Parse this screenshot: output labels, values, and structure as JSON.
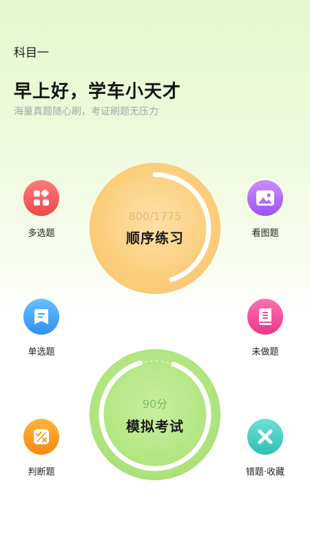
{
  "header": {
    "subject": "科目一",
    "greeting": "早上好，学车小天才",
    "slogan": "海量真题随心刷，考证刷题无压力"
  },
  "practice": {
    "count": "800/1775",
    "title": "顺序练习",
    "progress": 0.45
  },
  "exam": {
    "score": "90分",
    "title": "模拟考试",
    "progress": 0.9
  },
  "features": {
    "multiple": {
      "label": "多选题",
      "icon": "grid-icon",
      "color": "#f25a5a"
    },
    "picture": {
      "label": "看图题",
      "icon": "image-icon",
      "color": "#b36bf2"
    },
    "single": {
      "label": "单选题",
      "icon": "bookmark-icon",
      "color": "#3da0f5"
    },
    "undone": {
      "label": "未做题",
      "icon": "book-icon",
      "color": "#f2479a"
    },
    "judge": {
      "label": "判断题",
      "icon": "check-cross-icon",
      "color": "#fb9b1c"
    },
    "wrong": {
      "label": "错题·收藏",
      "icon": "close-icon",
      "color": "#40cfc6"
    }
  }
}
